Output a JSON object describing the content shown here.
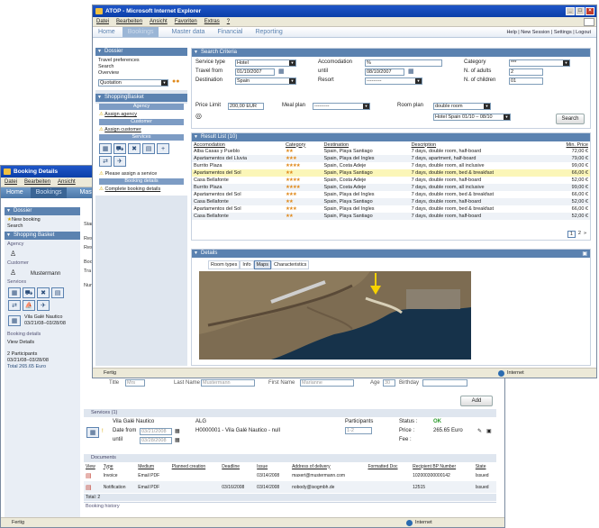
{
  "front": {
    "title": "ATOP - Microsoft Internet Explorer",
    "menu": [
      "Datei",
      "Bearbeiten",
      "Ansicht",
      "Favoriten",
      "Extras",
      "?"
    ],
    "nav": {
      "tabs": [
        "Home",
        "Bookings",
        "Master data",
        "Financial",
        "Reporting"
      ],
      "right": "Help | New Session | Settings | Logout"
    },
    "dossier": {
      "header": "Dossier",
      "items": [
        "Travel preferences",
        "Search",
        "Overview"
      ],
      "select": "Quotation"
    },
    "basket": {
      "header": "ShoppingBasket",
      "agency_head": "Agency",
      "agency_link": "Assign agency",
      "customer_head": "Customer",
      "customer_link": "Assign customer",
      "services_head": "Services",
      "assign_service": "Please assign a service",
      "booking_head": "Booking details",
      "booking_link": "Complete booking details"
    },
    "search": {
      "header": "Search Criteria",
      "service_type_label": "Service type",
      "service_type": "Hotel",
      "accomodation_label": "Accomodation",
      "accomodation": "%",
      "category_label": "Category",
      "category": "***",
      "travel_from_label": "Travel from",
      "travel_from": "01/10/2007",
      "until_label": "until",
      "until": "08/10/2007",
      "adults_label": "N. of adults",
      "adults": "2",
      "destination_label": "Destination",
      "destination": "Spain",
      "resort_label": "Resort",
      "resort": "---------",
      "children_label": "N. of children",
      "children": "01",
      "price_limit_label": "Price Limit",
      "price_limit": "200,00 EUR",
      "meal_label": "Meal plan",
      "meal": "---------",
      "room_label": "Room plan",
      "room": "double room",
      "hotel_sel": "Hotel Spain 01/10 – 08/10",
      "search_btn": "Search"
    },
    "results": {
      "header": "Result List (10)",
      "columns": [
        "Accomodation",
        "Category",
        "Destination",
        "Description",
        "Min. Price"
      ],
      "rows": [
        {
          "acc": "Alba Casas y Pueblo",
          "cat": "★★",
          "dest": "Spain, Playa Santiago",
          "desc": "7 days, double room, half-board",
          "price": "72,00 €"
        },
        {
          "acc": "Apartamentos del Lluvia",
          "cat": "★★★",
          "dest": "Spain, Playa del Ingles",
          "desc": "7 days, apartment, half-board",
          "price": "79,00 €"
        },
        {
          "acc": "Burrito Plaza",
          "cat": "★★★★",
          "dest": "Spain, Costa Adeje",
          "desc": "7 days, double room, all inclusive",
          "price": "99,00 €"
        },
        {
          "acc": "Apartamentos del Sol",
          "cat": "★★",
          "dest": "Spain, Playa Santiago",
          "desc": "7 days, double room, bed & breakfast",
          "price": "66,00 €"
        },
        {
          "acc": "Casa Bellafonte",
          "cat": "★★★★",
          "dest": "Spain, Costa Adeje",
          "desc": "7 days, double room, half-board",
          "price": "52,00 €"
        },
        {
          "acc": "Burrito Plaza",
          "cat": "★★★★",
          "dest": "Spain, Costa Adeje",
          "desc": "7 days, double room, all inclusive",
          "price": "99,00 €"
        },
        {
          "acc": "Apartamentos del Sol",
          "cat": "★★★",
          "dest": "Spain, Playa del Ingles",
          "desc": "7 days, double room, bed & breakfast",
          "price": "66,00 €"
        },
        {
          "acc": "Casa Bellafonte",
          "cat": "★★",
          "dest": "Spain, Playa Santiago",
          "desc": "7 days, double room, half-board",
          "price": "52,00 €"
        },
        {
          "acc": "Apartamentos del Sol",
          "cat": "★★★",
          "dest": "Spain, Playa del Ingles",
          "desc": "7 days, double room, bed & breakfast",
          "price": "66,00 €"
        },
        {
          "acc": "Casa Bellafonte",
          "cat": "★★",
          "dest": "Spain, Playa Santiago",
          "desc": "7 days, double room, half-board",
          "price": "52,00 €"
        }
      ],
      "pages": [
        "1",
        "2",
        "»"
      ]
    },
    "details": {
      "header": "Details",
      "tabs": [
        "Room types",
        "Info",
        "Maps",
        "Characteristics"
      ]
    },
    "status": "Fertig",
    "zone": "Internet"
  },
  "back": {
    "title": "Booking Details",
    "menu": [
      "Datei",
      "Bearbeiten",
      "Ansicht"
    ],
    "nav": [
      "Home",
      "Bookings",
      "Master Data"
    ],
    "dossier_head": "Dossier",
    "new_booking": "New booking",
    "search": "Search",
    "basket_head": "Shopping Basket",
    "agency_head": "Agency",
    "customer_head": "Customer",
    "customer_name": "Mustermann",
    "services_head": "Services",
    "hotel_name": "Vila Galé Nautico",
    "hotel_dates": "03/21/08–03/28/08",
    "booking_head": "Booking details",
    "view_details": "View Details",
    "participants": "2 Participants",
    "date_range": "03/21/08–03/28/08",
    "total": "Total 265.65 Euro",
    "partial_labels": [
      "Start",
      "Res",
      "Res",
      "Boo",
      "Tra",
      "Num"
    ],
    "traveller_row": {
      "title": "Title",
      "title_val": "Mrs",
      "last": "Last Name",
      "last_val": "Mustermann",
      "first": "First Name",
      "first_val": "Marianne",
      "age": "Age",
      "age_val": "30",
      "birthday": "Birthday"
    },
    "add_btn": "Add",
    "services_section": "Services (1)",
    "service": {
      "name": "Vila Galé Nautico",
      "code": "ALG",
      "date_from_label": "Date from",
      "date_from": "03/21/2008",
      "until_label": "until",
      "until": "03/28/2008",
      "ref": "H0000001 - Vila Galé Nautico - null",
      "participants_label": "Participants",
      "participants": "1-2",
      "status_label": "Status :",
      "status": "OK",
      "price_label": "Price :",
      "price": "265.65 Euro",
      "fee_label": "Fee :"
    },
    "documents_section": "Documents",
    "doc_columns": [
      "View",
      "Type",
      "Medium",
      "Planned creation",
      "Deadline",
      "Issue",
      "Address of delivery",
      "Formatted Doc",
      "Recipient BP Number",
      "State"
    ],
    "docs": [
      {
        "type": "Invoice",
        "medium": "Email PDF",
        "planned": "",
        "deadline": "",
        "issue": "03/14/2008",
        "address": "maxert@mustermann.com",
        "formatted": "",
        "bp": "102000300000142",
        "state": "Issued"
      },
      {
        "type": "Notification",
        "medium": "Email PDF",
        "planned": "",
        "deadline": "03/16/2008",
        "issue": "03/14/2008",
        "address": "nobody@isogmbh.de",
        "formatted": "",
        "bp": "12515",
        "state": "Issued"
      }
    ],
    "doc_total": "Total: 2",
    "history": "Booking history",
    "status": "Fertig",
    "zone": "Internet"
  }
}
